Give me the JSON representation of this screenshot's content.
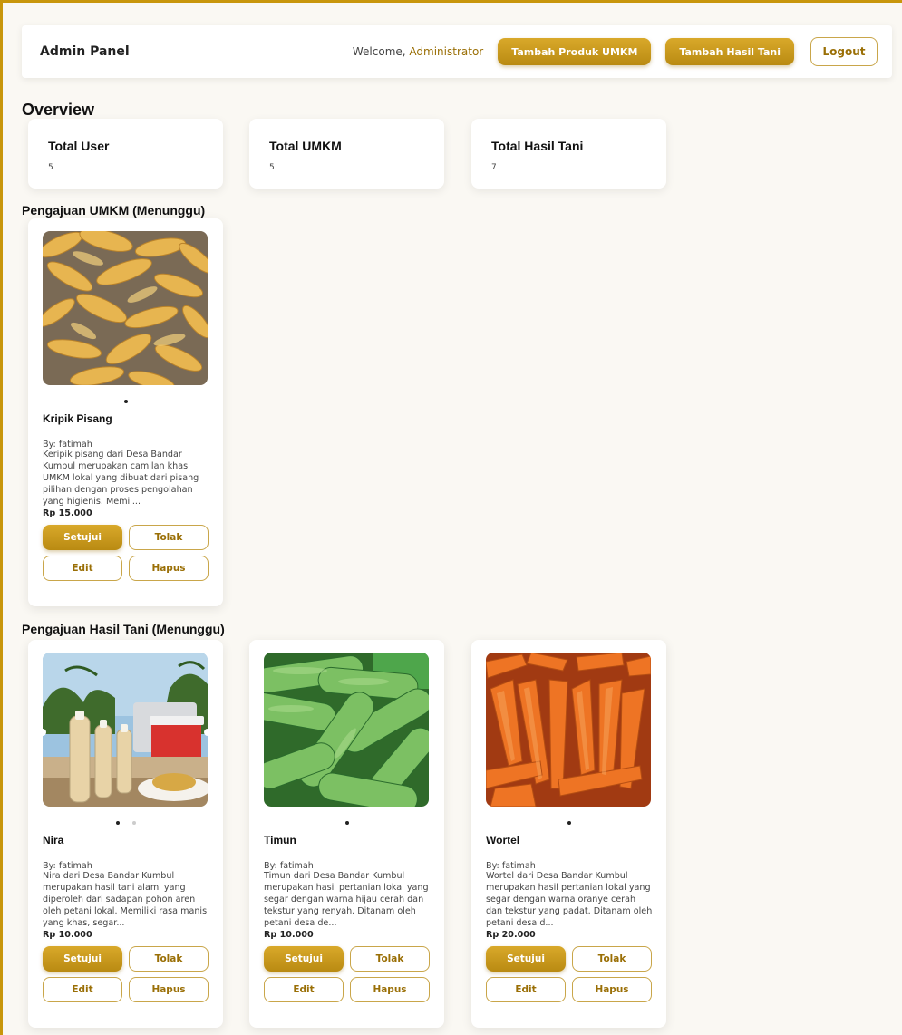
{
  "header": {
    "brand": "Admin Panel",
    "welcome_prefix": "Welcome, ",
    "username": "Administrator",
    "add_umkm_label": "Tambah Produk UMKM",
    "add_tani_label": "Tambah Hasil Tani",
    "logout_label": "Logout"
  },
  "overview": {
    "title": "Overview",
    "stats": [
      {
        "label": "Total User",
        "value": "5"
      },
      {
        "label": "Total UMKM",
        "value": "5"
      },
      {
        "label": "Total Hasil Tani",
        "value": "7"
      }
    ]
  },
  "umkm_section": {
    "title": "Pengajuan UMKM (Menunggu)",
    "items": [
      {
        "name": "Kripik Pisang",
        "by": "By: fatimah",
        "description": "Keripik pisang dari Desa Bandar Kumbul merupakan camilan khas UMKM lokal yang dibuat dari pisang pilihan dengan proses pengolahan yang higienis. Memil...",
        "price": "Rp 15.000",
        "image": "banana-chips-photo"
      }
    ]
  },
  "tani_section": {
    "title": "Pengajuan Hasil Tani (Menunggu)",
    "items": [
      {
        "name": "Nira",
        "by": "By: fatimah",
        "description": "Nira dari Desa Bandar Kumbul merupakan hasil tani alami yang diperoleh dari sadapan pohon aren oleh petani lokal. Memiliki rasa manis yang khas, segar...",
        "price": "Rp 10.000",
        "image": "palm-sap-bottles-photo"
      },
      {
        "name": "Timun",
        "by": "By: fatimah",
        "description": "Timun dari Desa Bandar Kumbul merupakan hasil pertanian lokal yang segar dengan warna hijau cerah dan tekstur yang renyah. Ditanam oleh petani desa de...",
        "price": "Rp 10.000",
        "image": "cucumbers-photo"
      },
      {
        "name": "Wortel",
        "by": "By: fatimah",
        "description": "Wortel dari Desa Bandar Kumbul merupakan hasil pertanian lokal yang segar dengan warna oranye cerah dan tekstur yang padat. Ditanam oleh petani desa d...",
        "price": "Rp 20.000",
        "image": "carrots-photo"
      }
    ]
  },
  "card_actions": {
    "approve": "Setujui",
    "reject": "Tolak",
    "edit": "Edit",
    "delete": "Hapus"
  },
  "colors": {
    "accent": "#c8960c",
    "accent_text": "#9a6f06",
    "background": "#faf8f3"
  }
}
